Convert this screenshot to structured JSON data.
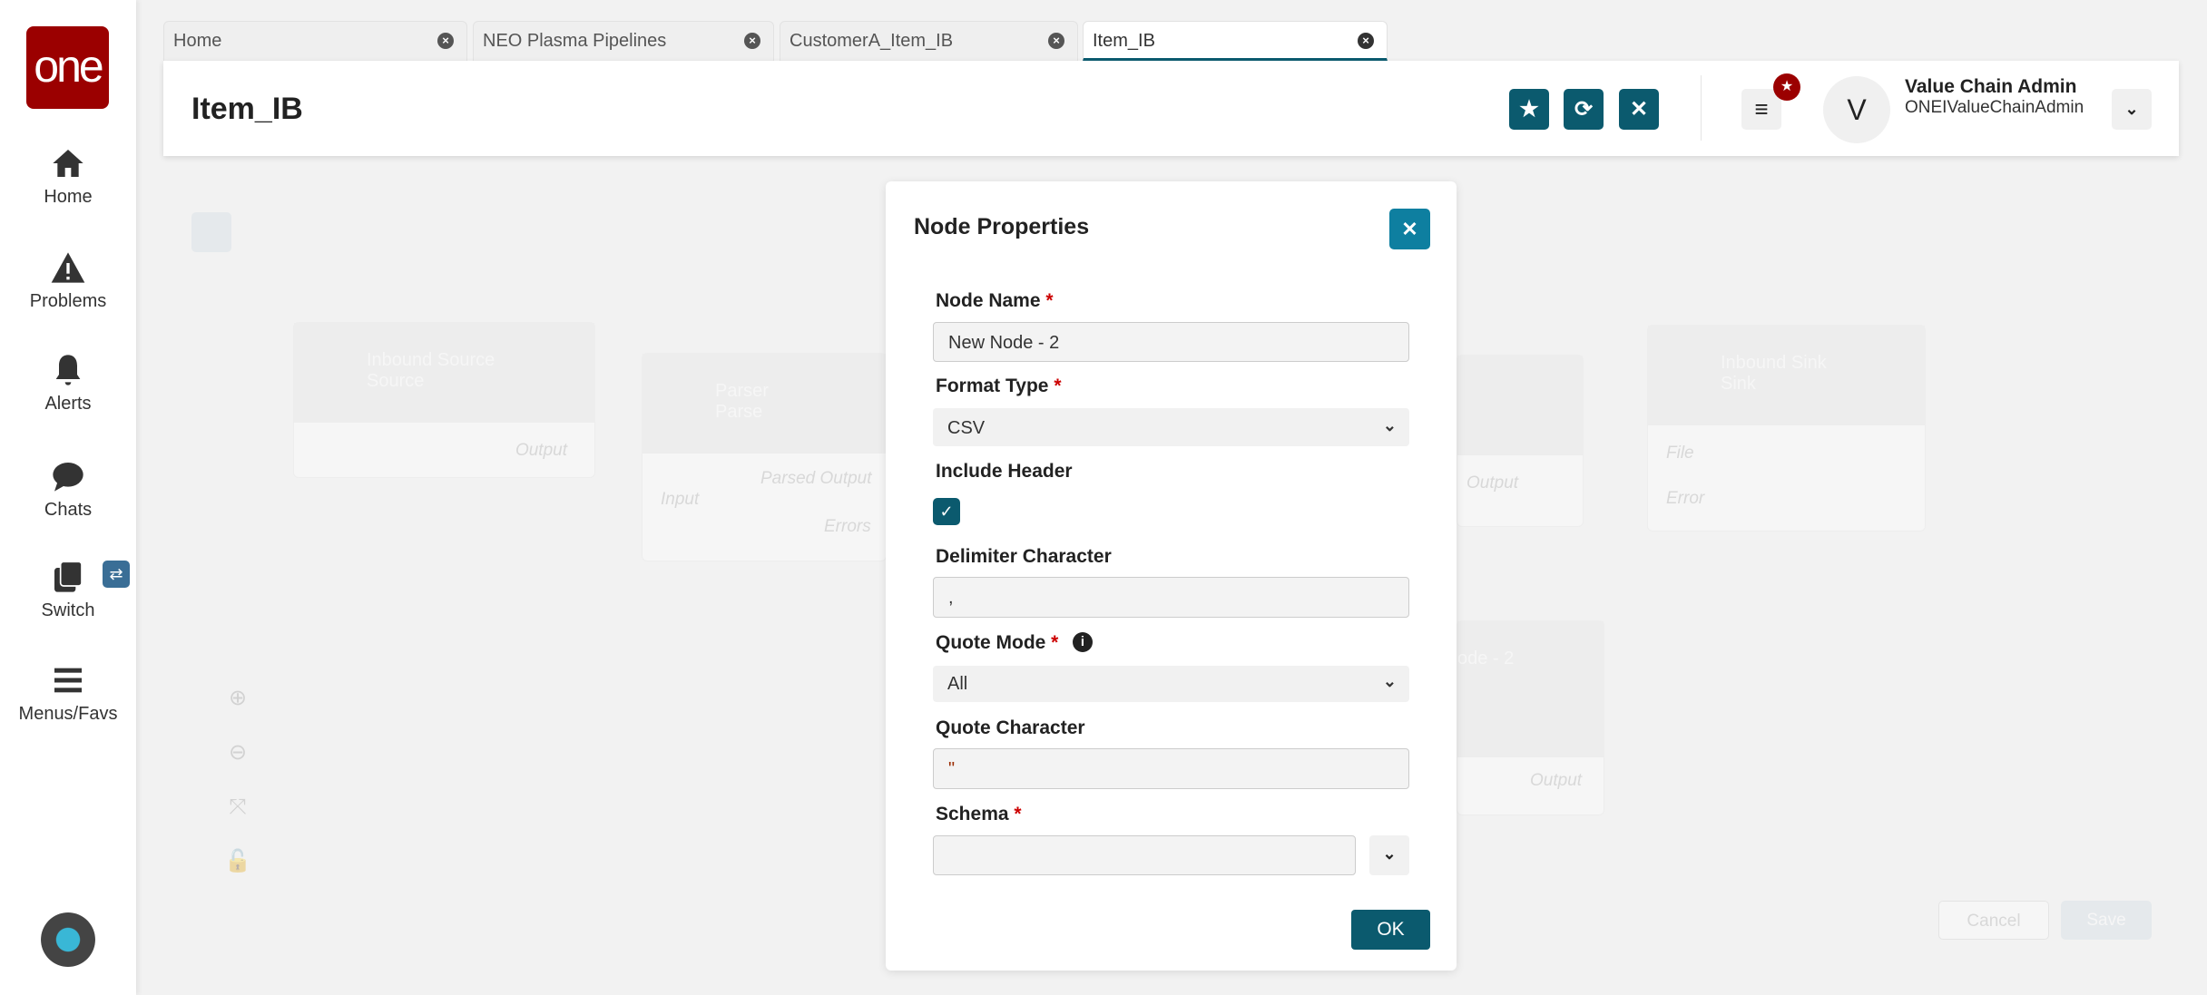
{
  "sidebar": {
    "logo": "one",
    "items": [
      {
        "label": "Home"
      },
      {
        "label": "Problems"
      },
      {
        "label": "Alerts"
      },
      {
        "label": "Chats"
      },
      {
        "label": "Switch"
      },
      {
        "label": "Menus/Favs"
      }
    ]
  },
  "tabs": [
    {
      "label": "Home"
    },
    {
      "label": "NEO Plasma Pipelines"
    },
    {
      "label": "CustomerA_Item_IB"
    },
    {
      "label": "Item_IB"
    }
  ],
  "header": {
    "title": "Item_IB",
    "user_name": "Value Chain Admin",
    "user_id": "ONEIValueChainAdmin",
    "avatar_initial": "V"
  },
  "canvas": {
    "nodes": [
      {
        "title": "Inbound Source",
        "sub": "Source",
        "port": "Output"
      },
      {
        "title": "Parser",
        "sub": "Parse",
        "in": "Input",
        "out1": "Parsed Output",
        "out2": "Errors"
      },
      {
        "port": "Output"
      },
      {
        "title": "Inbound Sink",
        "sub": "Sink",
        "in1": "File",
        "in2": "Error"
      },
      {
        "title": "ode - 2",
        "port": "Output"
      }
    ],
    "cancel": "Cancel",
    "save": "Save"
  },
  "modal": {
    "title": "Node Properties",
    "node_name_label": "Node Name",
    "node_name": "New Node - 2",
    "format_label": "Format Type",
    "format": "CSV",
    "header_label": "Include Header",
    "header_checked": true,
    "delim_label": "Delimiter Character",
    "delim": ",",
    "quote_mode_label": "Quote Mode",
    "quote_mode": "All",
    "quote_char_label": "Quote Character",
    "quote_char": "\"",
    "schema_label": "Schema",
    "schema": "",
    "ok": "OK",
    "required": "*"
  },
  "colors": {
    "accent": "#0b5a6e",
    "close": "#0e7fa0",
    "brand": "#9b0000"
  }
}
